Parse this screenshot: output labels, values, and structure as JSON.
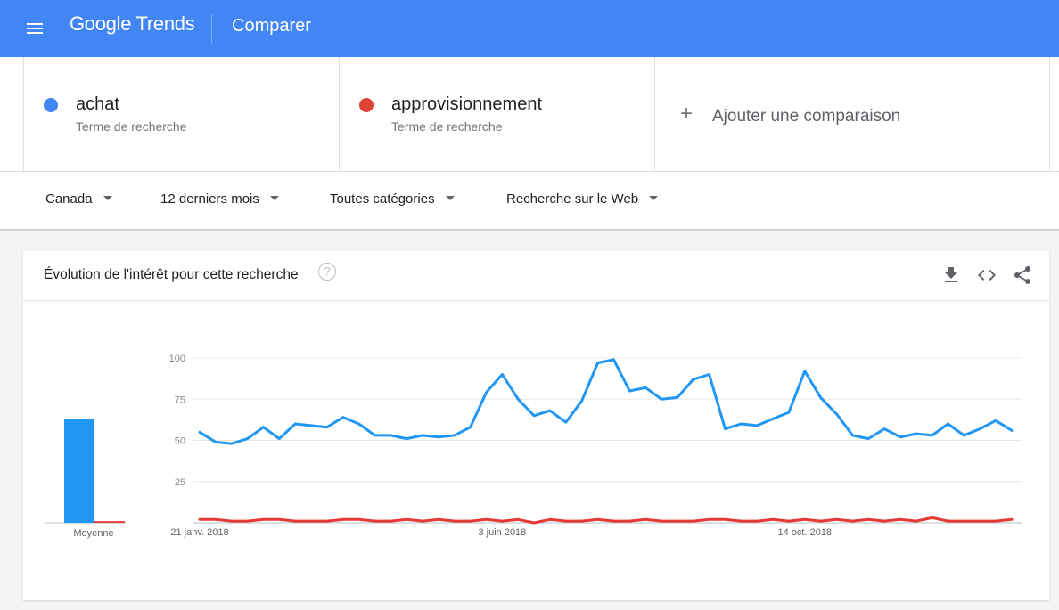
{
  "header": {
    "logo": "Google Trends",
    "page_title": "Comparer"
  },
  "terms": [
    {
      "name": "achat",
      "type": "Terme de recherche",
      "color": "#4285f4"
    },
    {
      "name": "approvisionnement",
      "type": "Terme de recherche",
      "color": "#db4437"
    }
  ],
  "add_comparison": {
    "plus": "+",
    "label": "Ajouter une comparaison"
  },
  "filters": {
    "region": "Canada",
    "period": "12 derniers mois",
    "category": "Toutes catégories",
    "search_type": "Recherche sur le Web"
  },
  "card": {
    "title": "Évolution de l'intérêt pour cette recherche",
    "help": "?"
  },
  "chart_data": [
    {
      "type": "bar",
      "categories": [
        "Moyenne"
      ],
      "series": [
        {
          "name": "achat",
          "values": [
            63
          ],
          "color": "#2196f3"
        },
        {
          "name": "approvisionnement",
          "values": [
            1
          ],
          "color": "#e53935"
        }
      ],
      "ylim": [
        0,
        100
      ]
    },
    {
      "type": "line",
      "xlabel": "",
      "ylabel": "",
      "ylim": [
        0,
        100
      ],
      "yticks": [
        25,
        50,
        75,
        100
      ],
      "xtick_labels": [
        {
          "index": 0,
          "label": "21 janv. 2018"
        },
        {
          "index": 19,
          "label": "3 juin 2018"
        },
        {
          "index": 38,
          "label": "14 oct. 2018"
        }
      ],
      "grid": true,
      "series": [
        {
          "name": "achat",
          "color": "#2196f3",
          "values": [
            55,
            49,
            48,
            51,
            58,
            51,
            60,
            59,
            58,
            64,
            60,
            53,
            53,
            51,
            53,
            52,
            53,
            58,
            79,
            90,
            75,
            65,
            68,
            61,
            74,
            97,
            99,
            80,
            82,
            75,
            76,
            87,
            90,
            57,
            60,
            59,
            63,
            67,
            92,
            76,
            66,
            53,
            51,
            57,
            52,
            54,
            53,
            60,
            53,
            57,
            62,
            56
          ]
        },
        {
          "name": "approvisionnement",
          "color": "#e53935",
          "values": [
            2,
            2,
            1,
            1,
            2,
            2,
            1,
            1,
            1,
            2,
            2,
            1,
            1,
            2,
            1,
            2,
            1,
            1,
            2,
            1,
            2,
            0,
            2,
            1,
            1,
            2,
            1,
            1,
            2,
            1,
            1,
            1,
            2,
            2,
            1,
            1,
            2,
            1,
            2,
            1,
            2,
            1,
            2,
            1,
            2,
            1,
            3,
            1,
            1,
            1,
            1,
            2
          ]
        }
      ]
    }
  ]
}
